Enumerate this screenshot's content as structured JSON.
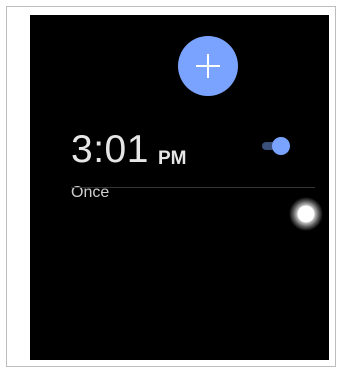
{
  "fab": {
    "icon": "plus-icon",
    "color": "#7aa3ff"
  },
  "alarm": {
    "time": "3:01",
    "ampm": "PM",
    "repeat": "Once",
    "enabled": true,
    "toggle_color": "#7aa3ff"
  },
  "side_indicator": {
    "icon": "circle-icon"
  }
}
